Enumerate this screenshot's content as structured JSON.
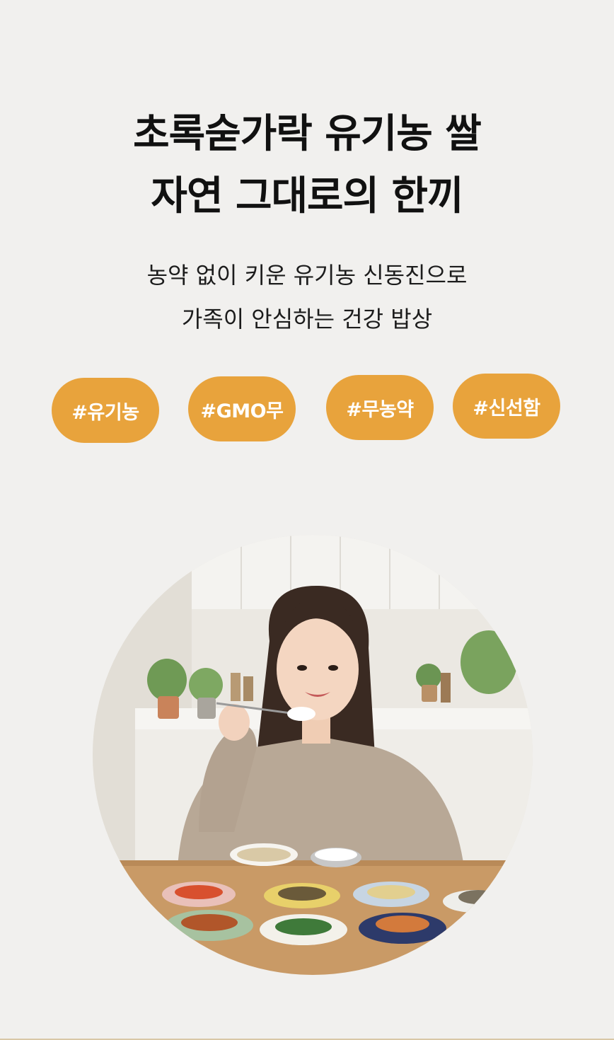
{
  "headline": {
    "line1": "초록숟가락 유기농 쌀",
    "line2": "자연 그대로의 한끼"
  },
  "subtext": {
    "line1": "농약 없이 키운 유기농 신동진으로",
    "line2": "가족이 안심하는 건강 밥상"
  },
  "tags": [
    {
      "label": "#유기농"
    },
    {
      "label": "#GMO무"
    },
    {
      "label": "#무농약"
    },
    {
      "label": "#신선함"
    }
  ],
  "colors": {
    "background": "#f1f0ee",
    "tag": "#e8a33c",
    "tag_text": "#ffffff"
  }
}
